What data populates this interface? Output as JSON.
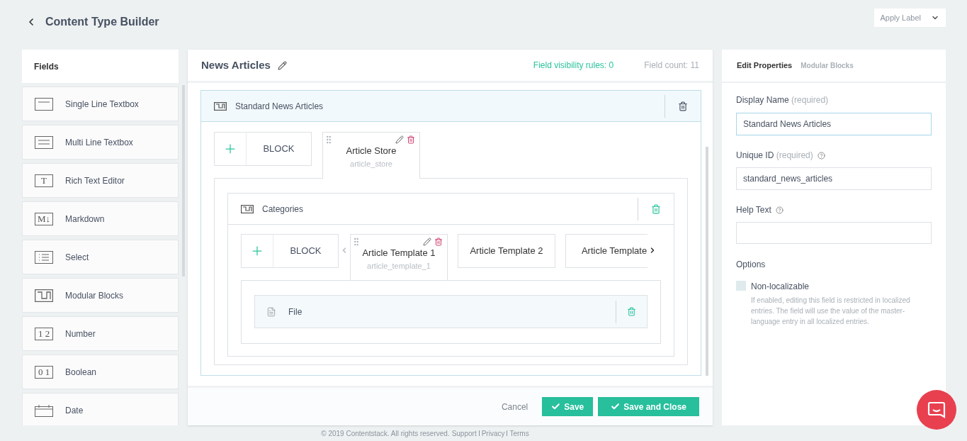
{
  "header": {
    "title": "Content Type Builder",
    "apply_label": "Apply Label"
  },
  "fields_panel": {
    "title": "Fields",
    "items": [
      {
        "label": "Single Line Textbox",
        "kind": "single_line"
      },
      {
        "label": "Multi Line Textbox",
        "kind": "multi_line"
      },
      {
        "label": "Rich Text Editor",
        "kind": "glyph",
        "glyph": "T"
      },
      {
        "label": "Markdown",
        "kind": "glyph",
        "glyph": "M↓"
      },
      {
        "label": "Select",
        "kind": "select"
      },
      {
        "label": "Modular Blocks",
        "kind": "modular"
      },
      {
        "label": "Number",
        "kind": "glyph",
        "glyph": "1 2"
      },
      {
        "label": "Boolean",
        "kind": "glyph",
        "glyph": "0 1"
      },
      {
        "label": "Date",
        "kind": "date"
      }
    ]
  },
  "builder": {
    "title": "News Articles",
    "visibility_rules": "Field visibility rules: 0",
    "field_count": "Field count: 11",
    "block": {
      "title": "Standard News Articles",
      "add_label": "BLOCK",
      "tabs": [
        {
          "name": "Article Store",
          "uid": "article_store",
          "selected": true
        }
      ],
      "inner": {
        "title": "Categories",
        "add_label": "BLOCK",
        "tabs": [
          {
            "name": "Article Template 1",
            "uid": "article_template_1",
            "selected": true
          },
          {
            "name": "Article Template 2",
            "selected": false
          },
          {
            "name": "Article Template",
            "selected": false
          }
        ],
        "field": {
          "title": "File"
        }
      }
    },
    "actions": {
      "cancel": "Cancel",
      "save": "Save",
      "save_close": "Save and Close"
    }
  },
  "properties": {
    "title": "Edit Properties",
    "subtitle": "Modular Blocks",
    "display_name": {
      "label": "Display Name",
      "note": "(required)",
      "value": "Standard News Articles"
    },
    "unique_id": {
      "label": "Unique ID",
      "note": "(required)",
      "value": "standard_news_articles"
    },
    "help_text": {
      "label": "Help Text"
    },
    "options": {
      "title": "Options",
      "items": [
        {
          "label": "Non-localizable",
          "checked": false,
          "description": "If enabled, editing this field is restricted in localized entries. The field will use the value of the master-language entry in all localized entries."
        }
      ]
    }
  },
  "footer": {
    "copyright": "© 2019 Contentstack. All rights reserved.",
    "links": [
      "Support",
      "Privacy",
      "Terms"
    ]
  }
}
